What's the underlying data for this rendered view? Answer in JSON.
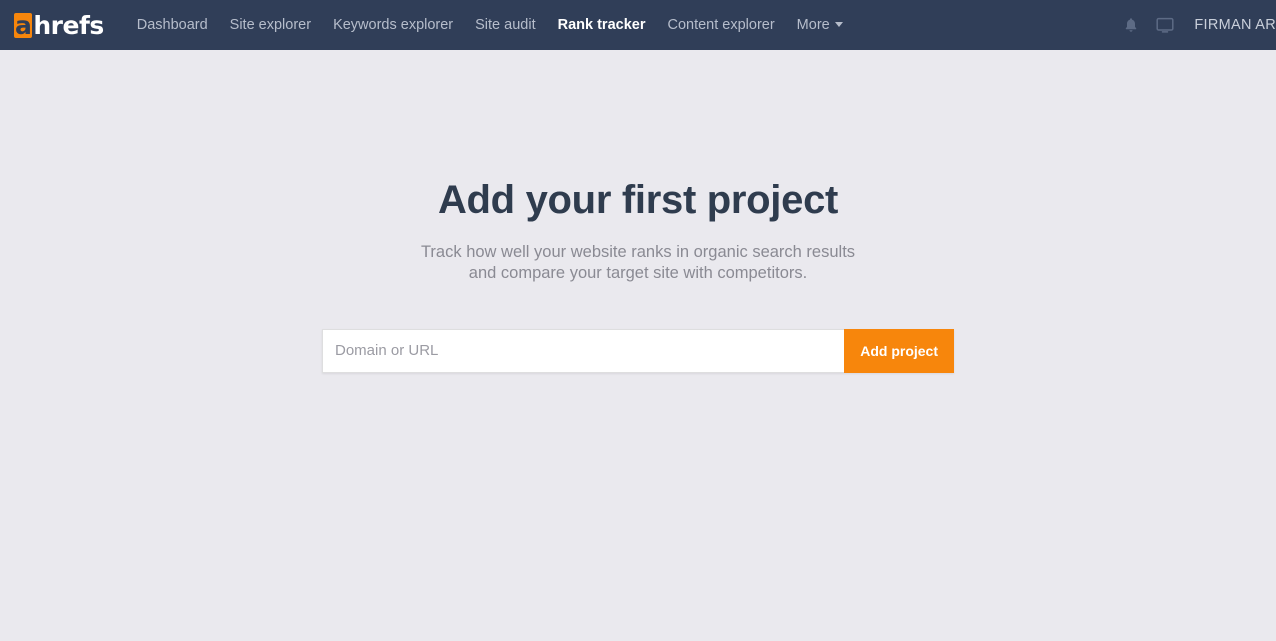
{
  "header": {
    "logo": {
      "first_letter": "a",
      "rest": "hrefs"
    },
    "nav": [
      {
        "label": "Dashboard",
        "name": "nav-item-dashboard",
        "active": false
      },
      {
        "label": "Site explorer",
        "name": "nav-item-site-explorer",
        "active": false
      },
      {
        "label": "Keywords explorer",
        "name": "nav-item-keywords-explorer",
        "active": false
      },
      {
        "label": "Site audit",
        "name": "nav-item-site-audit",
        "active": false
      },
      {
        "label": "Rank tracker",
        "name": "nav-item-rank-tracker",
        "active": true
      },
      {
        "label": "Content explorer",
        "name": "nav-item-content-explorer",
        "active": false
      },
      {
        "label": "More",
        "name": "nav-item-more",
        "active": false,
        "has_caret": true
      }
    ],
    "icons": [
      {
        "name": "bell-icon",
        "label": "notifications"
      },
      {
        "name": "monitor-icon",
        "label": "display"
      }
    ],
    "account_name": "FIRMAN AR",
    "colors": {
      "bar_background": "#303e58",
      "nav_text": "#b6bdcb",
      "nav_active_text": "#ffffff",
      "logo_accent": "#f7860c"
    }
  },
  "main": {
    "title": "Add your first project",
    "subtitle": "Track how well your website ranks in organic search results and compare your target site with competitors.",
    "form": {
      "input_placeholder": "Domain or URL",
      "input_value": "",
      "submit_label": "Add project"
    },
    "colors": {
      "page_background": "#eae9ee",
      "title_text": "#2f3c4e",
      "subtitle_text": "#8a8a93",
      "button_background": "#f7860c",
      "button_text": "#ffffff",
      "input_background": "#ffffff"
    }
  }
}
